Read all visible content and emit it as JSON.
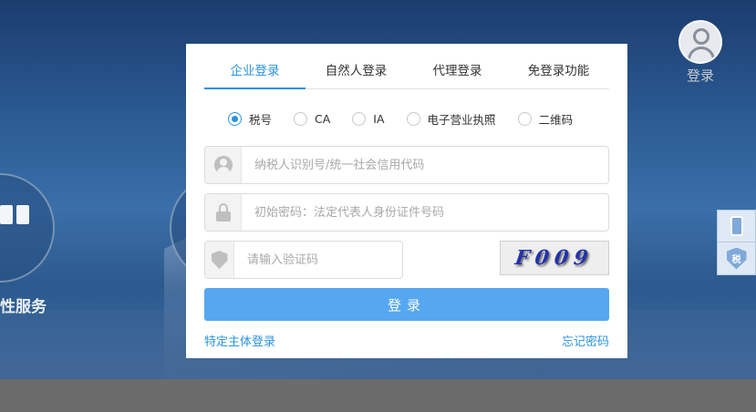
{
  "header": {
    "login_label": "登录"
  },
  "background": {
    "service_label": "性服务"
  },
  "side_tools": {
    "tax_badge": "税"
  },
  "tabs": [
    {
      "label": "企业登录",
      "active": true
    },
    {
      "label": "自然人登录",
      "active": false
    },
    {
      "label": "代理登录",
      "active": false
    },
    {
      "label": "免登录功能",
      "active": false
    }
  ],
  "login_types": [
    {
      "label": "税号",
      "checked": true
    },
    {
      "label": "CA",
      "checked": false
    },
    {
      "label": "IA",
      "checked": false
    },
    {
      "label": "电子营业执照",
      "checked": false
    },
    {
      "label": "二维码",
      "checked": false
    }
  ],
  "form": {
    "taxpayer_id_placeholder": "纳税人识别号/统一社会信用代码",
    "password_placeholder": "初始密码：法定代表人身份证件号码",
    "captcha_placeholder": "请输入验证码",
    "captcha_text": "F009",
    "submit_label": "登录",
    "special_login_link": "特定主体登录",
    "forgot_password_link": "忘记密码"
  },
  "colors": {
    "accent": "#2a93df",
    "button": "#55a7ef",
    "background": "#2a5a92"
  }
}
